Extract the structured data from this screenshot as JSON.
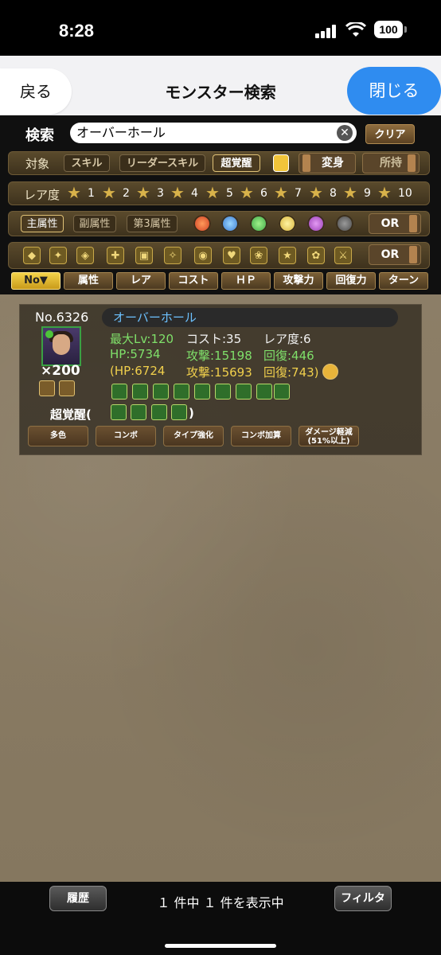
{
  "status_bar": {
    "time": "8:28",
    "battery": "100"
  },
  "nav": {
    "back_label": "戻る",
    "title": "モンスター検索",
    "close_label": "閉じる"
  },
  "search": {
    "label": "検索",
    "value": "オーバーホール",
    "clear_label": "クリア"
  },
  "target": {
    "label": "対象",
    "options": [
      "スキル",
      "リーダースキル",
      "超覚醒"
    ],
    "transform_label": "変身",
    "owned_label": "所持"
  },
  "rarity": {
    "label": "レア度",
    "stars": [
      "1",
      "2",
      "3",
      "4",
      "5",
      "6",
      "7",
      "8",
      "9",
      "10"
    ]
  },
  "attributes": {
    "options": [
      "主属性",
      "副属性",
      "第3属性"
    ],
    "orbs": [
      "fire-orb",
      "water-orb",
      "wood-orb",
      "light-orb",
      "dark-orb",
      "none-orb"
    ],
    "mode": "OR"
  },
  "awakenings": {
    "mode": "OR"
  },
  "sort": {
    "buttons": [
      "No▼",
      "属性",
      "レア",
      "コスト",
      "ＨＰ",
      "攻撃力",
      "回復力",
      "ターン"
    ]
  },
  "result": {
    "number": "No.6326",
    "name": "オーバーホール",
    "plus": "×200",
    "max_lv": "最大Lv:120",
    "cost": "コスト:35",
    "rarity": "レア度:6",
    "hp": "HP:5734",
    "atk": "攻撃:15198",
    "rcv": "回復:446",
    "hp_limit": "(HP:6724",
    "atk_limit": "攻撃:15693",
    "rcv_limit": "回復:743)",
    "super_awaken_label": "超覚醒(",
    "super_awaken_close": ")",
    "tags": [
      "多色",
      "コンボ",
      "タイプ強化",
      "コンボ加算",
      "ダメージ軽減",
      "(51%以上)"
    ]
  },
  "footer": {
    "history_label": "履歴",
    "count_text": "１ 件中 １ 件を表示中",
    "filter_label": "フィルタ"
  },
  "colors": {
    "accent_blue": "#2f8cf0",
    "stat_green": "#7fe06a",
    "limit_yellow": "#f0cf4c",
    "name_blue": "#6cc1ff"
  }
}
